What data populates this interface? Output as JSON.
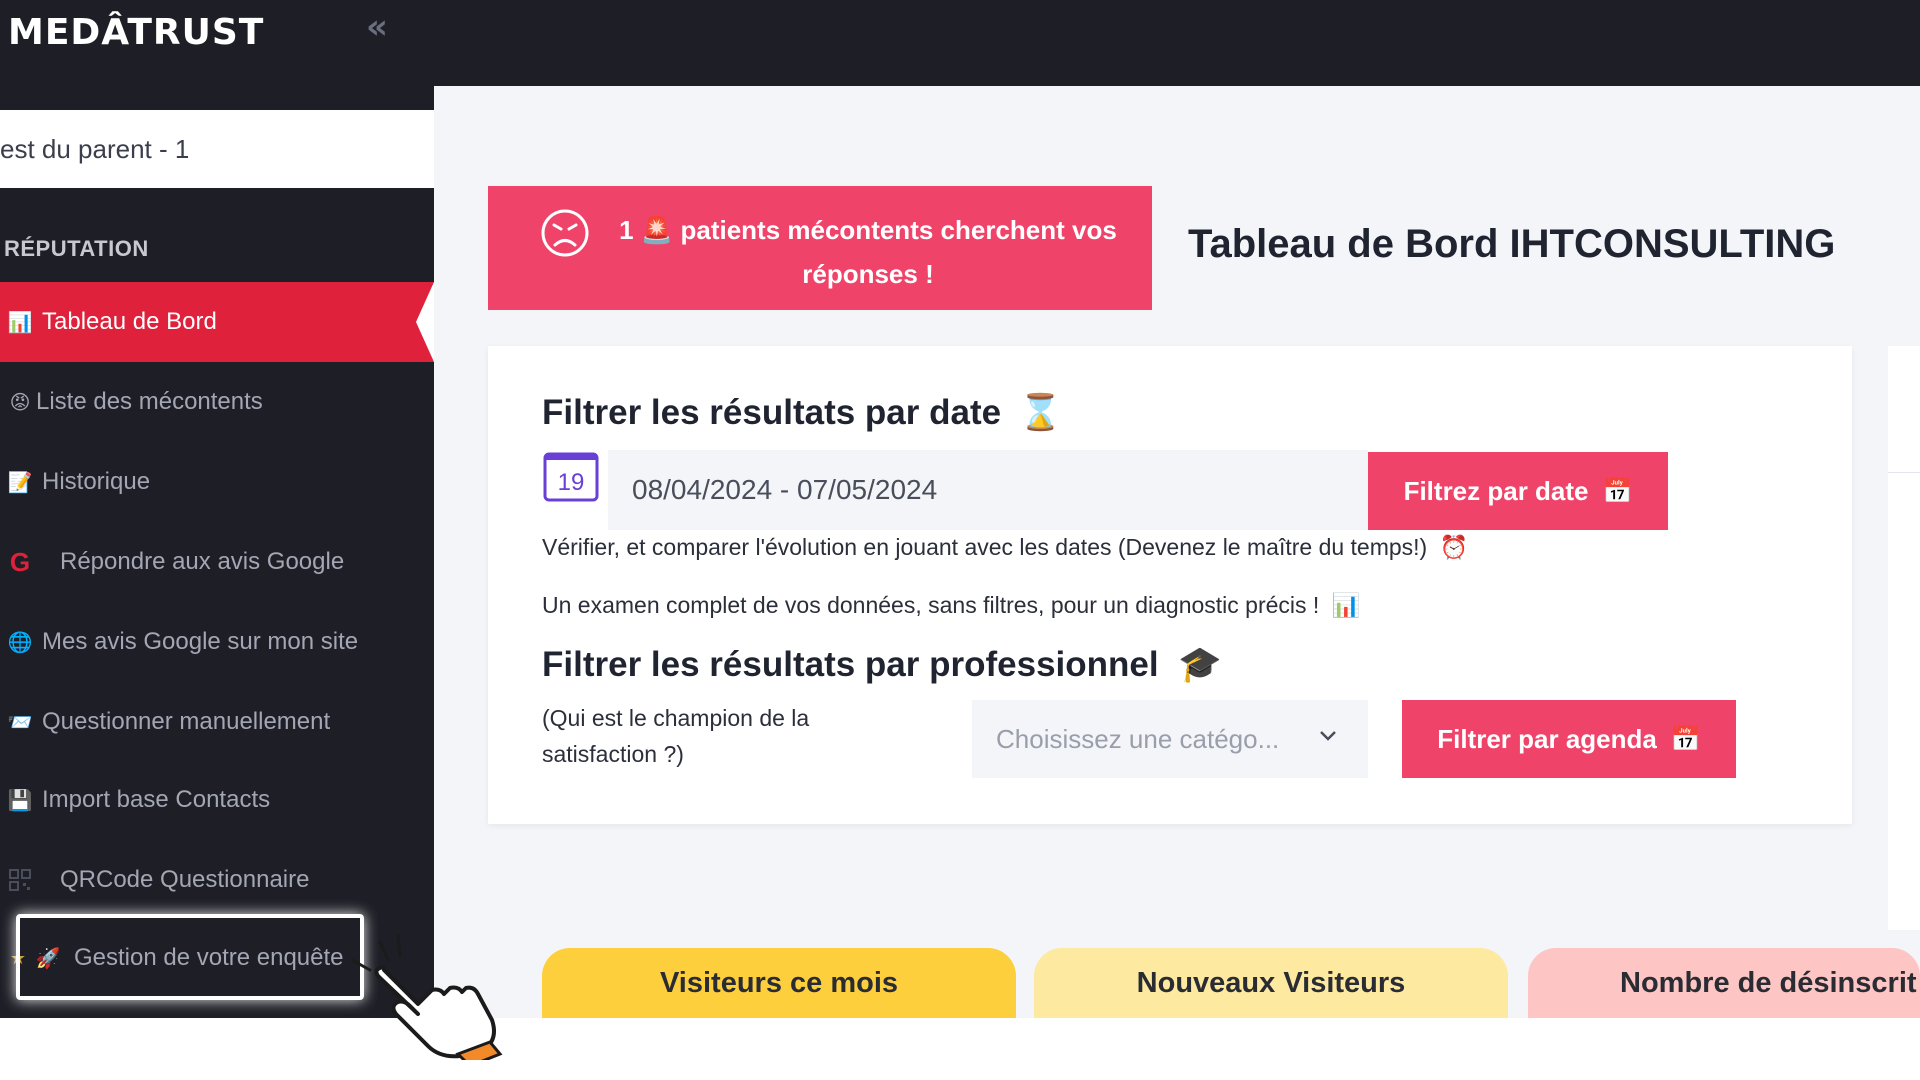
{
  "brand": {
    "logo_text": "MEDÂTRUST"
  },
  "sidebar": {
    "parent_label": "est du parent - 1",
    "section_title": "RÉPUTATION",
    "items": [
      {
        "label": "Tableau de Bord",
        "icon": "bar-chart-icon",
        "glyph": "📊"
      },
      {
        "label": "Liste des mécontents",
        "icon": "angry-face-icon",
        "glyph": "😡"
      },
      {
        "label": "Historique",
        "icon": "memo-icon",
        "glyph": "📝"
      },
      {
        "label": "Répondre aux avis Google",
        "icon": "google-icon",
        "glyph": "G"
      },
      {
        "label": "Mes avis Google sur mon site",
        "icon": "globe-icon",
        "glyph": "🌐"
      },
      {
        "label": "Questionner manuellement",
        "icon": "envelope-icon",
        "glyph": "📨"
      },
      {
        "label": "Import base Contacts",
        "icon": "floppy-disk-icon",
        "glyph": "💾"
      },
      {
        "label": "QRCode Questionnaire",
        "icon": "qrcode-icon",
        "glyph": ""
      },
      {
        "label": "Gestion de votre enquête",
        "icon": "rocket-icon",
        "glyph": "🚀"
      }
    ]
  },
  "alert": {
    "count": "1",
    "icon": "siren-icon",
    "line1": "patients mécontents cherchent vos",
    "line2": "réponses !"
  },
  "main": {
    "title": "Tableau de Bord IHTCONSULTING",
    "date_filter": {
      "heading": "Filtrer les résultats par date",
      "heading_icon": "hourglass-icon",
      "calendar_day": "19",
      "date_range": "08/04/2024 - 07/05/2024",
      "button_label": "Filtrez par date",
      "note1": "Vérifier, et comparer l'évolution en jouant avec les dates (Devenez le maître du temps!)",
      "note1_icon": "alarm-clock-icon",
      "note2": "Un examen complet de vos données, sans filtres, pour un diagnostic précis !",
      "note2_icon": "bar-chart-icon"
    },
    "pro_filter": {
      "heading": "Filtrer les résultats par professionnel",
      "heading_icon": "graduation-cap-icon",
      "note": "(Qui est le champion de la satisfaction ?)",
      "select_placeholder": "Choisissez une catégo...",
      "button_label": "Filtrer par agenda"
    },
    "stats": [
      {
        "label": "Visiteurs ce mois",
        "color": "#fdcf3c"
      },
      {
        "label": "Nouveaux Visiteurs",
        "color": "#fde9a0"
      },
      {
        "label": "Nombre de désinscrit",
        "color": "#fdc5c3"
      }
    ]
  },
  "colors": {
    "sidebar_bg": "#1e1e26",
    "accent_pink": "#f0436a",
    "active_red": "#e0213c"
  }
}
